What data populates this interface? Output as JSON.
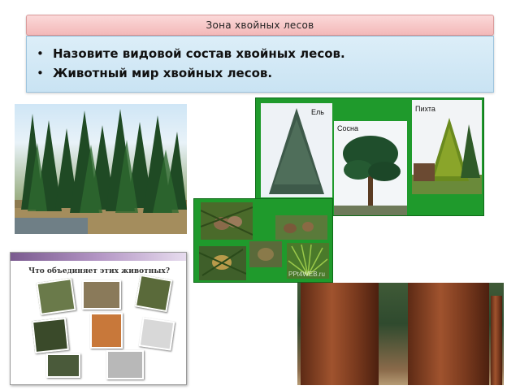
{
  "title": "Зона хвойных лесов",
  "bullets": [
    "Назовите видовой состав хвойных лесов.",
    "Животный мир хвойных лесов."
  ],
  "collage": {
    "labels": [
      "Ель",
      "Сосна",
      "Пихта"
    ],
    "watermark": "PPt4WEB.ru"
  },
  "animals_slide": {
    "question": "Что объединяет этих животных?"
  },
  "colors": {
    "title_bg": "#f3b8b8",
    "content_bg": "#c9e3f3",
    "collage_green": "#1f9a2c"
  }
}
